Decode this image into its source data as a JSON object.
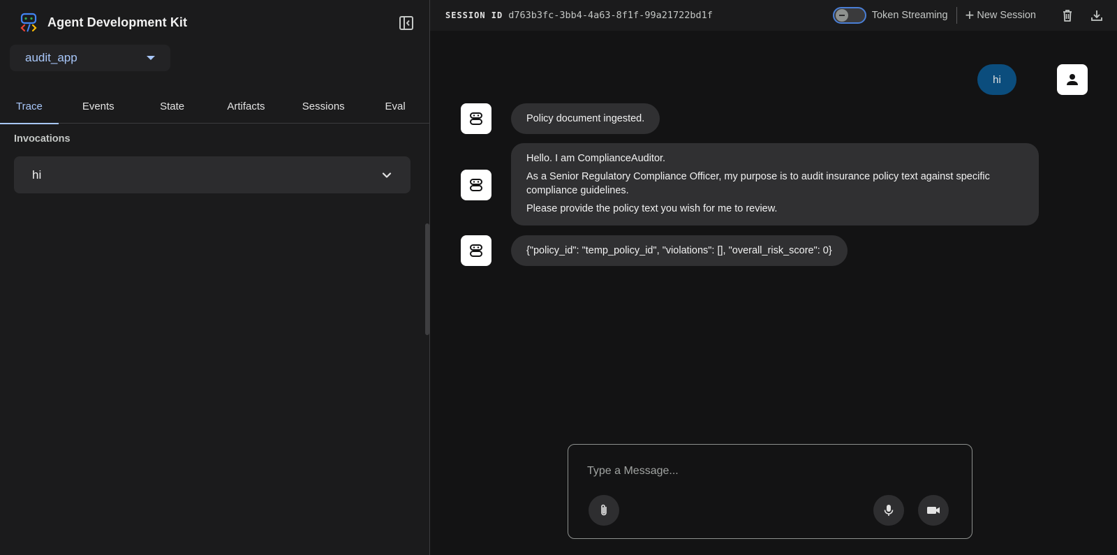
{
  "sidebar": {
    "app_title": "Agent Development Kit",
    "selected_app": "audit_app",
    "tabs": [
      {
        "label": "Trace",
        "active": true
      },
      {
        "label": "Events",
        "active": false
      },
      {
        "label": "State",
        "active": false
      },
      {
        "label": "Artifacts",
        "active": false
      },
      {
        "label": "Sessions",
        "active": false
      },
      {
        "label": "Eval",
        "active": false
      }
    ],
    "section_label": "Invocations",
    "invocations": [
      {
        "label": "hi"
      }
    ]
  },
  "topbar": {
    "session_label": "SESSION ID",
    "session_id": "d763b3fc-3bb4-4a63-8f1f-99a21722bd1f",
    "token_streaming_label": "Token Streaming",
    "token_streaming_on": false,
    "new_session_label": "New Session"
  },
  "chat": {
    "messages": [
      {
        "role": "user",
        "text": "hi"
      },
      {
        "role": "agent",
        "lines": [
          "Policy document ingested."
        ]
      },
      {
        "role": "agent",
        "lines": [
          "Hello. I am ComplianceAuditor.",
          "As a Senior Regulatory Compliance Officer, my purpose is to audit insurance policy text against specific compliance guidelines.",
          "Please provide the policy text you wish for me to review."
        ]
      },
      {
        "role": "agent",
        "lines": [
          "{\"policy_id\": \"temp_policy_id\", \"violations\": [], \"overall_risk_score\": 0}"
        ]
      }
    ]
  },
  "composer": {
    "placeholder": "Type a Message..."
  },
  "colors": {
    "accent": "#a8c7fa",
    "user_bubble": "#0b4d7d",
    "agent_bubble": "#303032",
    "background": "#131314",
    "sidebar": "#1b1b1c"
  }
}
